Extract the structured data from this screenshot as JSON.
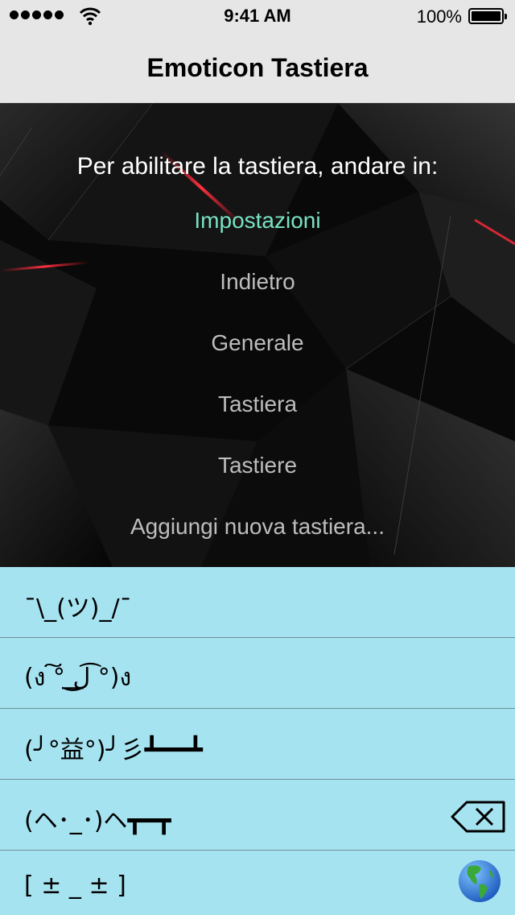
{
  "status": {
    "time": "9:41 AM",
    "battery": "100%"
  },
  "nav": {
    "title": "Emoticon Tastiera"
  },
  "instructions": {
    "headline": "Per abilitare la tastiera, andare in:",
    "steps": [
      "Impostazioni",
      "Indietro",
      "Generale",
      "Tastiera",
      "Tastiere",
      "Aggiungi nuova tastiera..."
    ],
    "highlight_color": "#79e2c2"
  },
  "keyboard": {
    "emoticons": [
      "¯\\_(ツ)_/¯",
      "(ง ͠° ͟ل͜ ͡°)ง",
      "(╯°益°)╯彡┻━━┻",
      "(ヘ･_･)ヘ┳━┳",
      "[ ± _ ± ]"
    ],
    "background_color": "#a6e3f1",
    "backspace_icon": "backspace-icon",
    "globe_icon": "globe-icon"
  }
}
